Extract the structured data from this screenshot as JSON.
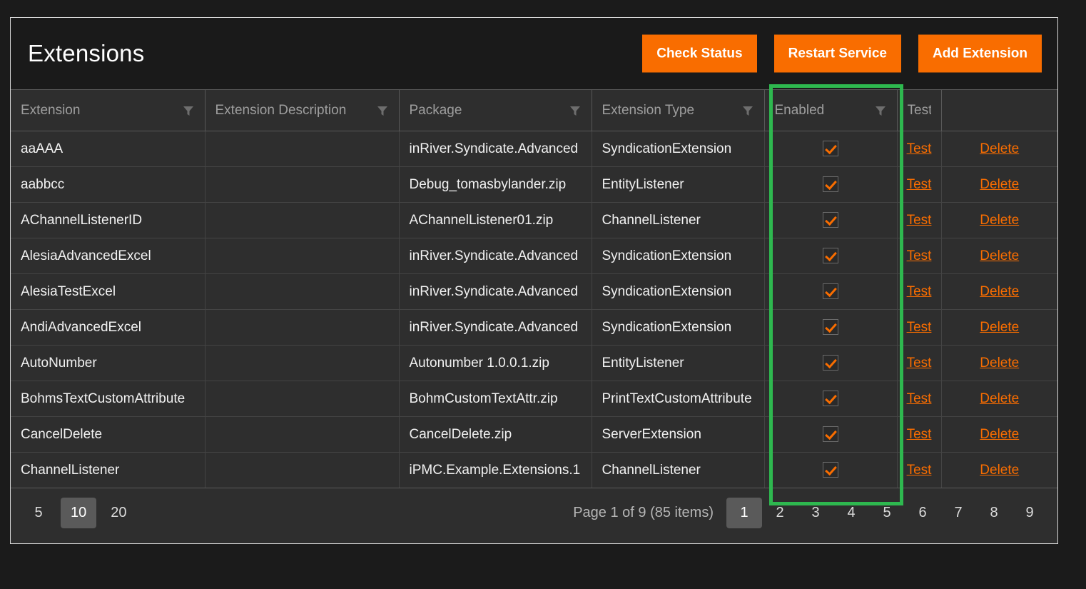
{
  "header": {
    "title": "Extensions",
    "buttons": [
      {
        "label": "Check Status",
        "name": "check-status-button"
      },
      {
        "label": "Restart Service",
        "name": "restart-service-button"
      },
      {
        "label": "Add Extension",
        "name": "add-extension-button"
      }
    ]
  },
  "table": {
    "columns": [
      {
        "label": "Extension",
        "filter": true
      },
      {
        "label": "Extension Description",
        "filter": true
      },
      {
        "label": "Package",
        "filter": true
      },
      {
        "label": "Extension Type",
        "filter": true
      },
      {
        "label": "Enabled",
        "filter": true
      },
      {
        "label": "Test",
        "filter": false
      },
      {
        "label": "",
        "filter": false
      }
    ],
    "row_actions": {
      "test": "Test",
      "delete": "Delete"
    },
    "rows": [
      {
        "extension": "aaAAA",
        "description": "",
        "package": "inRiver.Syndicate.Advanced",
        "type": "SyndicationExtension",
        "enabled": true
      },
      {
        "extension": "aabbcc",
        "description": "",
        "package": "Debug_tomasbylander.zip",
        "type": "EntityListener",
        "enabled": true
      },
      {
        "extension": "AChannelListenerID",
        "description": "",
        "package": "AChannelListener01.zip",
        "type": "ChannelListener",
        "enabled": true
      },
      {
        "extension": "AlesiaAdvancedExcel",
        "description": "",
        "package": "inRiver.Syndicate.Advanced",
        "type": "SyndicationExtension",
        "enabled": true
      },
      {
        "extension": "AlesiaTestExcel",
        "description": "",
        "package": "inRiver.Syndicate.Advanced",
        "type": "SyndicationExtension",
        "enabled": true
      },
      {
        "extension": "AndiAdvancedExcel",
        "description": "",
        "package": "inRiver.Syndicate.Advanced",
        "type": "SyndicationExtension",
        "enabled": true
      },
      {
        "extension": "AutoNumber",
        "description": "",
        "package": "Autonumber 1.0.0.1.zip",
        "type": "EntityListener",
        "enabled": true
      },
      {
        "extension": "BohmsTextCustomAttribute",
        "description": "",
        "package": "BohmCustomTextAttr.zip",
        "type": "PrintTextCustomAttribute",
        "enabled": true
      },
      {
        "extension": "CancelDelete",
        "description": "",
        "package": "CancelDelete.zip",
        "type": "ServerExtension",
        "enabled": true
      },
      {
        "extension": "ChannelListener",
        "description": "",
        "package": "iPMC.Example.Extensions.1",
        "type": "ChannelListener",
        "enabled": true
      }
    ]
  },
  "pager": {
    "page_sizes": [
      "5",
      "10",
      "20"
    ],
    "active_page_size": "10",
    "info": "Page 1 of 9 (85 items)",
    "pages": [
      "1",
      "2",
      "3",
      "4",
      "5",
      "6",
      "7",
      "8",
      "9"
    ],
    "active_page": "1"
  },
  "overlay": {
    "highlight_color": "#2eb84f",
    "target_column": "Enabled"
  },
  "colors": {
    "accent": "#f96d00",
    "page_background": "#1b1b1b",
    "toolbar_background": "#1a1a1a",
    "grid_background": "#2e2e2e"
  }
}
